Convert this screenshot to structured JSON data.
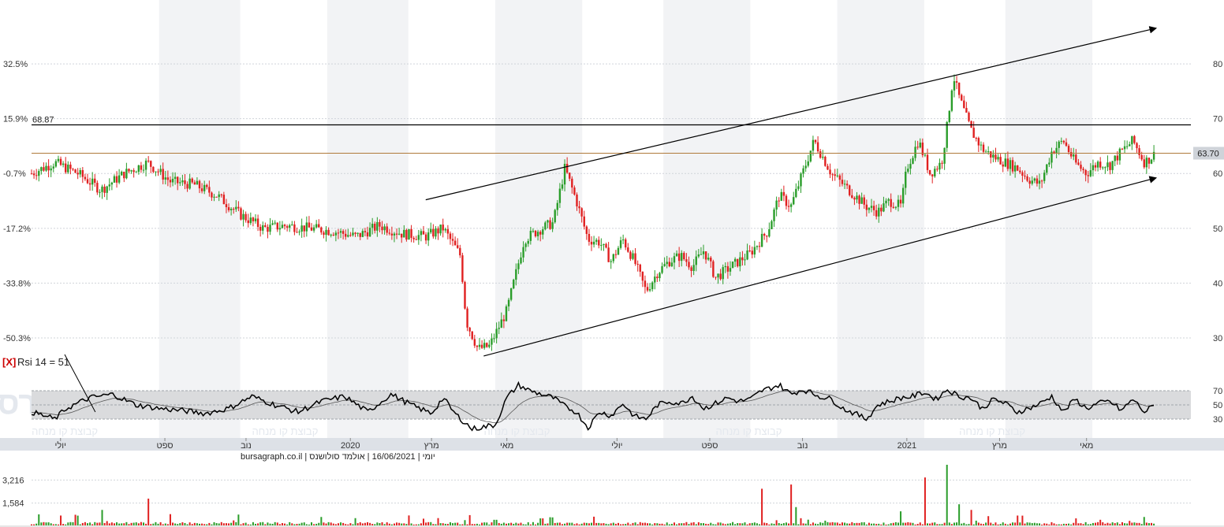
{
  "chart_data": {
    "type": "candlestick",
    "price_panel": {
      "left_ticks": [
        "32.5%",
        "15.9%",
        "-0.7%",
        "-17.2%",
        "-33.8%",
        "-50.3%"
      ],
      "left_tick_values": [
        80,
        70,
        60,
        50,
        40,
        30
      ],
      "right_ticks": [
        "80",
        "70",
        "60",
        "50",
        "40",
        "30"
      ],
      "right_tick_values": [
        80,
        70,
        60,
        50,
        40,
        30
      ],
      "ylim": [
        27.7,
        90.5
      ],
      "resistance": {
        "label": "68.87",
        "value": 68.87
      },
      "last_price": {
        "label": "63.70",
        "value": 63.7
      },
      "channel_upper": [
        [
          0.34,
          55.2
        ],
        [
          0.97,
          86.5
        ]
      ],
      "channel_lower": [
        [
          0.39,
          26.7
        ],
        [
          0.97,
          59.2
        ]
      ],
      "price_path": [
        [
          0.0,
          60.0
        ],
        [
          0.02,
          62.0
        ],
        [
          0.04,
          60.0
        ],
        [
          0.06,
          57.0
        ],
        [
          0.08,
          60.0
        ],
        [
          0.1,
          62.0
        ],
        [
          0.12,
          58.5
        ],
        [
          0.14,
          58.0
        ],
        [
          0.16,
          56.0
        ],
        [
          0.18,
          52.5
        ],
        [
          0.2,
          50.0
        ],
        [
          0.22,
          50.5
        ],
        [
          0.24,
          50.0
        ],
        [
          0.26,
          49.5
        ],
        [
          0.28,
          48.5
        ],
        [
          0.3,
          50.5
        ],
        [
          0.32,
          49.0
        ],
        [
          0.34,
          48.5
        ],
        [
          0.355,
          50.0
        ],
        [
          0.37,
          45.0
        ],
        [
          0.375,
          33.0
        ],
        [
          0.385,
          28.0
        ],
        [
          0.395,
          28.5
        ],
        [
          0.41,
          35.0
        ],
        [
          0.425,
          48.0
        ],
        [
          0.44,
          50.0
        ],
        [
          0.45,
          51.0
        ],
        [
          0.46,
          61.0
        ],
        [
          0.47,
          55.0
        ],
        [
          0.48,
          48.0
        ],
        [
          0.49,
          47.5
        ],
        [
          0.5,
          44.0
        ],
        [
          0.51,
          48.0
        ],
        [
          0.52,
          44.0
        ],
        [
          0.53,
          38.5
        ],
        [
          0.54,
          42.0
        ],
        [
          0.55,
          44.0
        ],
        [
          0.56,
          45.0
        ],
        [
          0.57,
          43.0
        ],
        [
          0.58,
          46.0
        ],
        [
          0.59,
          41.0
        ],
        [
          0.6,
          42.5
        ],
        [
          0.62,
          45.5
        ],
        [
          0.635,
          49.5
        ],
        [
          0.645,
          56.0
        ],
        [
          0.655,
          54.0
        ],
        [
          0.665,
          60.0
        ],
        [
          0.675,
          66.0
        ],
        [
          0.69,
          60.0
        ],
        [
          0.7,
          58.0
        ],
        [
          0.71,
          56.0
        ],
        [
          0.72,
          54.0
        ],
        [
          0.73,
          53.0
        ],
        [
          0.74,
          55.0
        ],
        [
          0.75,
          54.0
        ],
        [
          0.755,
          61.0
        ],
        [
          0.765,
          66.0
        ],
        [
          0.775,
          60.0
        ],
        [
          0.785,
          62.0
        ],
        [
          0.79,
          69.0
        ],
        [
          0.795,
          78.0
        ],
        [
          0.8,
          74.0
        ],
        [
          0.81,
          68.0
        ],
        [
          0.82,
          64.5
        ],
        [
          0.83,
          63.0
        ],
        [
          0.84,
          62.0
        ],
        [
          0.85,
          61.0
        ],
        [
          0.86,
          59.0
        ],
        [
          0.87,
          58.0
        ],
        [
          0.88,
          64.0
        ],
        [
          0.89,
          66.0
        ],
        [
          0.9,
          62.0
        ],
        [
          0.91,
          60.0
        ],
        [
          0.92,
          62.0
        ],
        [
          0.93,
          61.5
        ],
        [
          0.94,
          64.0
        ],
        [
          0.95,
          66.0
        ],
        [
          0.96,
          62.0
        ],
        [
          0.97,
          63.7
        ]
      ],
      "volume_ratio_note": "",
      "up_color": "#2a9d2a",
      "down_color": "#e02020"
    },
    "rsi_panel": {
      "label_prefix": "[X]",
      "label": "Rsi 14 = 51",
      "value": 51,
      "ticks": [
        "70",
        "50",
        "30"
      ],
      "tick_values": [
        70,
        50,
        30
      ],
      "ylim": [
        10,
        90
      ],
      "band": [
        30,
        70
      ],
      "rsi_path": [
        [
          0.0,
          40
        ],
        [
          0.02,
          30
        ],
        [
          0.03,
          45
        ],
        [
          0.05,
          60
        ],
        [
          0.07,
          65
        ],
        [
          0.09,
          50
        ],
        [
          0.11,
          45
        ],
        [
          0.13,
          42
        ],
        [
          0.15,
          38
        ],
        [
          0.17,
          45
        ],
        [
          0.19,
          62
        ],
        [
          0.21,
          50
        ],
        [
          0.23,
          40
        ],
        [
          0.25,
          55
        ],
        [
          0.27,
          62
        ],
        [
          0.29,
          40
        ],
        [
          0.31,
          65
        ],
        [
          0.33,
          48
        ],
        [
          0.345,
          38
        ],
        [
          0.355,
          60
        ],
        [
          0.365,
          38
        ],
        [
          0.38,
          16
        ],
        [
          0.4,
          22
        ],
        [
          0.41,
          60
        ],
        [
          0.42,
          78
        ],
        [
          0.43,
          70
        ],
        [
          0.44,
          65
        ],
        [
          0.45,
          60
        ],
        [
          0.46,
          48
        ],
        [
          0.47,
          40
        ],
        [
          0.48,
          18
        ],
        [
          0.49,
          40
        ],
        [
          0.5,
          35
        ],
        [
          0.51,
          52
        ],
        [
          0.52,
          34
        ],
        [
          0.53,
          30
        ],
        [
          0.54,
          50
        ],
        [
          0.55,
          55
        ],
        [
          0.56,
          52
        ],
        [
          0.57,
          62
        ],
        [
          0.58,
          45
        ],
        [
          0.59,
          52
        ],
        [
          0.6,
          60
        ],
        [
          0.61,
          55
        ],
        [
          0.62,
          58
        ],
        [
          0.63,
          70
        ],
        [
          0.645,
          78
        ],
        [
          0.655,
          65
        ],
        [
          0.665,
          72
        ],
        [
          0.68,
          62
        ],
        [
          0.69,
          58
        ],
        [
          0.7,
          45
        ],
        [
          0.71,
          38
        ],
        [
          0.72,
          30
        ],
        [
          0.73,
          50
        ],
        [
          0.74,
          55
        ],
        [
          0.75,
          60
        ],
        [
          0.76,
          62
        ],
        [
          0.77,
          68
        ],
        [
          0.78,
          58
        ],
        [
          0.79,
          72
        ],
        [
          0.8,
          62
        ],
        [
          0.81,
          60
        ],
        [
          0.82,
          45
        ],
        [
          0.83,
          58
        ],
        [
          0.84,
          52
        ],
        [
          0.85,
          40
        ],
        [
          0.86,
          45
        ],
        [
          0.87,
          52
        ],
        [
          0.88,
          62
        ],
        [
          0.89,
          40
        ],
        [
          0.9,
          58
        ],
        [
          0.91,
          45
        ],
        [
          0.92,
          52
        ],
        [
          0.93,
          55
        ],
        [
          0.94,
          42
        ],
        [
          0.95,
          58
        ],
        [
          0.96,
          40
        ],
        [
          0.97,
          51
        ]
      ]
    },
    "x_axis": {
      "labels": [
        "יולי",
        "ספט",
        "נוב",
        "2020",
        "מרץ",
        "מאי",
        "יולי",
        "ספט",
        "נוב",
        "2021",
        "מרץ",
        "מאי"
      ],
      "positions": [
        0.025,
        0.115,
        0.185,
        0.275,
        0.345,
        0.41,
        0.505,
        0.585,
        0.665,
        0.755,
        0.835,
        0.91
      ]
    },
    "caption": "יומי | 16/06/2021 | אולמד סולושנס | bursagraph.co.il",
    "volume_panel": {
      "ticks": [
        "3,216",
        "1,584"
      ],
      "tick_values": [
        3216,
        1584
      ],
      "ylim": [
        0,
        4300
      ],
      "spikes": [
        [
          0.06,
          1100
        ],
        [
          0.1,
          1900
        ],
        [
          0.12,
          800
        ],
        [
          0.25,
          600
        ],
        [
          0.4,
          400
        ],
        [
          0.44,
          500
        ],
        [
          0.63,
          2600
        ],
        [
          0.655,
          2900
        ],
        [
          0.66,
          1300
        ],
        [
          0.75,
          1000
        ],
        [
          0.77,
          3400
        ],
        [
          0.79,
          4300
        ],
        [
          0.8,
          1500
        ],
        [
          0.81,
          1100
        ],
        [
          0.85,
          700
        ],
        [
          0.9,
          500
        ],
        [
          0.96,
          600
        ]
      ]
    },
    "watermark": {
      "brand": "בורסהגרף",
      "sub": "קבוצת קו מנחה"
    }
  }
}
